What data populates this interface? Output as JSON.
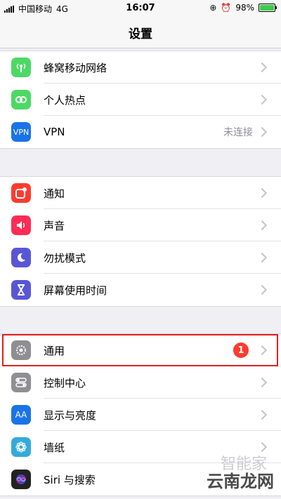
{
  "status": {
    "carrier": "中国移动",
    "network": "4G",
    "time": "16:07",
    "battery": "98%",
    "battery_level": 0.98
  },
  "nav": {
    "title": "设置"
  },
  "groups": [
    [
      {
        "label": "蜂窝移动网络",
        "icon": "cellular-antenna-icon",
        "color": "#4cd964"
      },
      {
        "label": "个人热点",
        "icon": "hotspot-link-icon",
        "color": "#4cd964"
      },
      {
        "label": "VPN",
        "icon": "vpn-icon",
        "icon_text": "VPN",
        "color": "#1a74e8",
        "value": "未连接"
      }
    ],
    [
      {
        "label": "通知",
        "icon": "notifications-icon",
        "color": "#ff3b30"
      },
      {
        "label": "声音",
        "icon": "speaker-icon",
        "color": "#ff2d55"
      },
      {
        "label": "勿扰模式",
        "icon": "moon-icon",
        "color": "#5856d6"
      },
      {
        "label": "屏幕使用时间",
        "icon": "hourglass-icon",
        "color": "#5856d6"
      }
    ],
    [
      {
        "label": "通用",
        "icon": "gear-icon",
        "color": "#8e8e93",
        "badge": "1"
      },
      {
        "label": "控制中心",
        "icon": "toggles-icon",
        "color": "#8e8e93"
      },
      {
        "label": "显示与亮度",
        "icon": "text-size-icon",
        "icon_text": "AA",
        "color": "#1a74e8"
      },
      {
        "label": "墙纸",
        "icon": "wallpaper-flower-icon",
        "color": "#34aadc"
      },
      {
        "label": "Siri 与搜索",
        "icon": "siri-icon",
        "color": "#222222"
      }
    ]
  ],
  "watermark": {
    "text": "云南龙网",
    "faint": "智能家"
  }
}
